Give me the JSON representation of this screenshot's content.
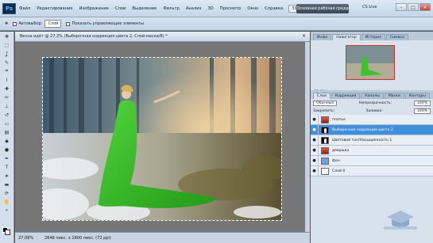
{
  "menubar": {
    "logo": "Ps",
    "items": [
      "Файл",
      "Редактирование",
      "Изображение",
      "Слои",
      "Выделение",
      "Фильтр",
      "Анализ",
      "3D",
      "Просмотр",
      "Окно",
      "Справка"
    ],
    "zoom_ctrl": "33,3",
    "workspace_button": "Основная рабочая среда",
    "cs_live": "CS Live"
  },
  "options": {
    "autoselect_label": "Автовыбор:",
    "autoselect_value": "Слой",
    "show_controls": "Показать управляющие элементы"
  },
  "document": {
    "tab_title": "Весна идёт @ 27,3% (Выборочная коррекция цвета 2, Слой-маска/8) *",
    "zoom": "27,08%",
    "doc_info": "2648 пикс. x 1800 пикс. (72 ppi)"
  },
  "panels": {
    "nav_tabs": [
      "Инфо",
      "Навигатор",
      "История",
      "Символ"
    ],
    "nav_zoom": "27,08%",
    "layer_tabs": [
      "Слои",
      "Коррекция",
      "Каналы",
      "Маски",
      "Контуры"
    ],
    "blend_mode": "Обычные",
    "opacity_label": "Непрозрачность:",
    "opacity_value": "100%",
    "lock_label": "Закрепить:",
    "fill_label": "Заливка:",
    "fill_value": "100%",
    "layers": [
      {
        "name": "платье",
        "thumb": "red",
        "selected": false
      },
      {
        "name": "Выборочная коррекция цвета 2",
        "thumb": "mask",
        "selected": true
      },
      {
        "name": "Цветовой тон/Насыщенность 1",
        "thumb": "mask",
        "selected": false
      },
      {
        "name": "девушка",
        "thumb": "red",
        "selected": false
      },
      {
        "name": "фон",
        "thumb": "blue",
        "selected": false
      },
      {
        "name": "Слой 0",
        "thumb": "white",
        "selected": false
      }
    ]
  },
  "colors": {
    "dress": "#39b82a",
    "selected_layer": "#3f8fdc"
  }
}
